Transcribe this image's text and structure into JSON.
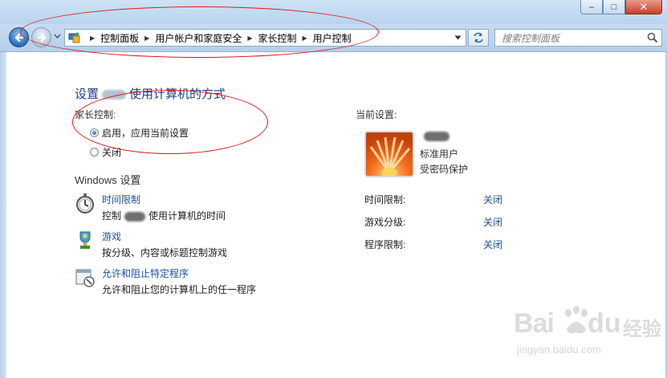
{
  "window": {
    "controls": [
      "–",
      "□",
      "✕"
    ]
  },
  "toolbar": {
    "breadcrumb": [
      "控制面板",
      "用户帐户和家庭安全",
      "家长控制",
      "用户控制"
    ],
    "search_placeholder": "搜索控制面板"
  },
  "main": {
    "heading_prefix": "设置",
    "heading_suffix": "使用计算机的方式",
    "parental_label": "家长控制:",
    "radio_on": "启用，应用当前设置",
    "radio_on_checked": true,
    "radio_off": "关闭",
    "windows_settings_label": "Windows 设置",
    "items": [
      {
        "title": "时间限制",
        "desc_prefix": "控制",
        "desc_suffix": "使用计算机的时间",
        "icon": "stopwatch-icon"
      },
      {
        "title": "游戏",
        "desc_prefix": "按分级、内容或标题控制游戏",
        "desc_suffix": "",
        "icon": "game-trophy-icon"
      },
      {
        "title": "允许和阻止特定程序",
        "desc_prefix": "允许和阻止您的计算机上的任一程序",
        "desc_suffix": "",
        "icon": "program-block-icon"
      }
    ]
  },
  "current": {
    "label": "当前设置:",
    "user_type": "标准用户",
    "password": "受密码保护",
    "settings": [
      {
        "name": "时间限制:",
        "value": "关闭"
      },
      {
        "name": "游戏分级:",
        "value": "关闭"
      },
      {
        "name": "程序限制:",
        "value": "关闭"
      }
    ]
  },
  "watermark": {
    "brand": "Bai",
    "brand2": "du",
    "cn": "经验",
    "url": "jingyan.baidu.com"
  },
  "colors": {
    "link": "#1e50a0",
    "heading": "#1e3f86",
    "annotation": "#d81c1c"
  }
}
